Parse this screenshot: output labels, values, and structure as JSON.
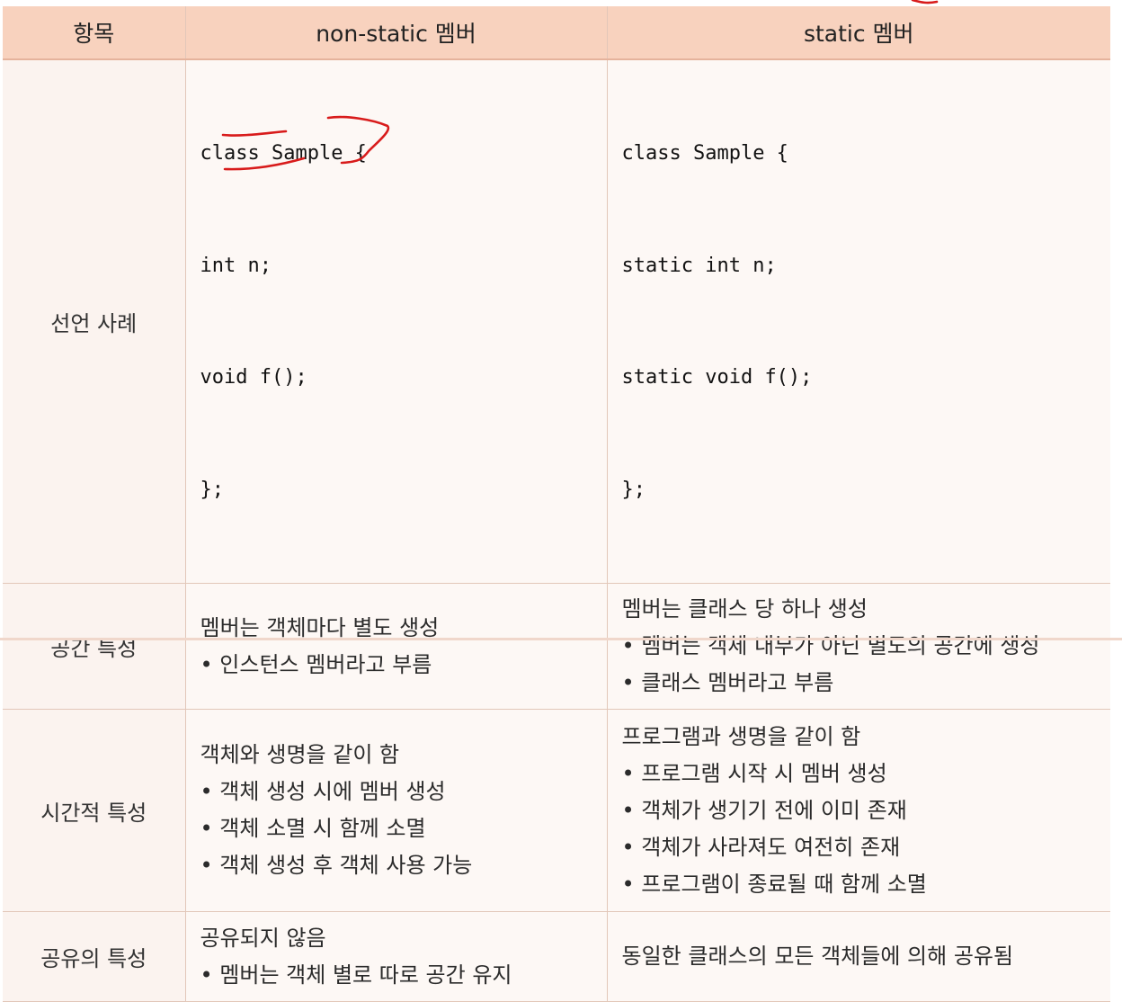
{
  "table": {
    "headers": [
      "항목",
      "non-static 멤버",
      "static 멤버"
    ],
    "rows": [
      {
        "label": "선언 사례",
        "nonstatic": [
          "class Sample {",
          "  int n;",
          "  void f();",
          "};"
        ],
        "static": [
          "class Sample {",
          "  static int n;",
          "  static void f();",
          "};"
        ]
      },
      {
        "label": "공간 특성",
        "nonstatic": {
          "title": "멤버는 객체마다 별도 생성",
          "bullets": [
            "인스턴스 멤버라고 부름"
          ]
        },
        "static": {
          "title": "멤버는 클래스 당 하나 생성",
          "bullets": [
            "멤버는 객체 내부가 아닌 별도의 공간에 생성",
            "클래스 멤버라고 부름"
          ]
        }
      },
      {
        "label": "시간적 특성",
        "nonstatic": {
          "title": "객체와 생명을 같이 함",
          "bullets": [
            "객체 생성 시에 멤버 생성",
            "객체 소멸 시 함께 소멸",
            "객체 생성 후 객체 사용 가능"
          ]
        },
        "static": {
          "title": "프로그램과 생명을 같이 함",
          "bullets": [
            "프로그램 시작 시 멤버 생성",
            "객체가 생기기 전에 이미 존재",
            "객체가 사라져도 여전히 존재",
            "프로그램이 종료될 때 함께 소멸"
          ]
        }
      },
      {
        "label": "공유의 특성",
        "nonstatic": {
          "title": "공유되지 않음",
          "bullets": [
            "멤버는 객체 별로 따로 공간 유지"
          ]
        },
        "static": {
          "title": "동일한 클래스의 모든 객체들에 의해 공유됨",
          "bullets": []
        }
      }
    ]
  },
  "colors": {
    "header_bg": "#f8d2be",
    "cell_bg": "#fdf8f5",
    "grid": "#e2c7b9",
    "annotation": "#d81b1b"
  }
}
